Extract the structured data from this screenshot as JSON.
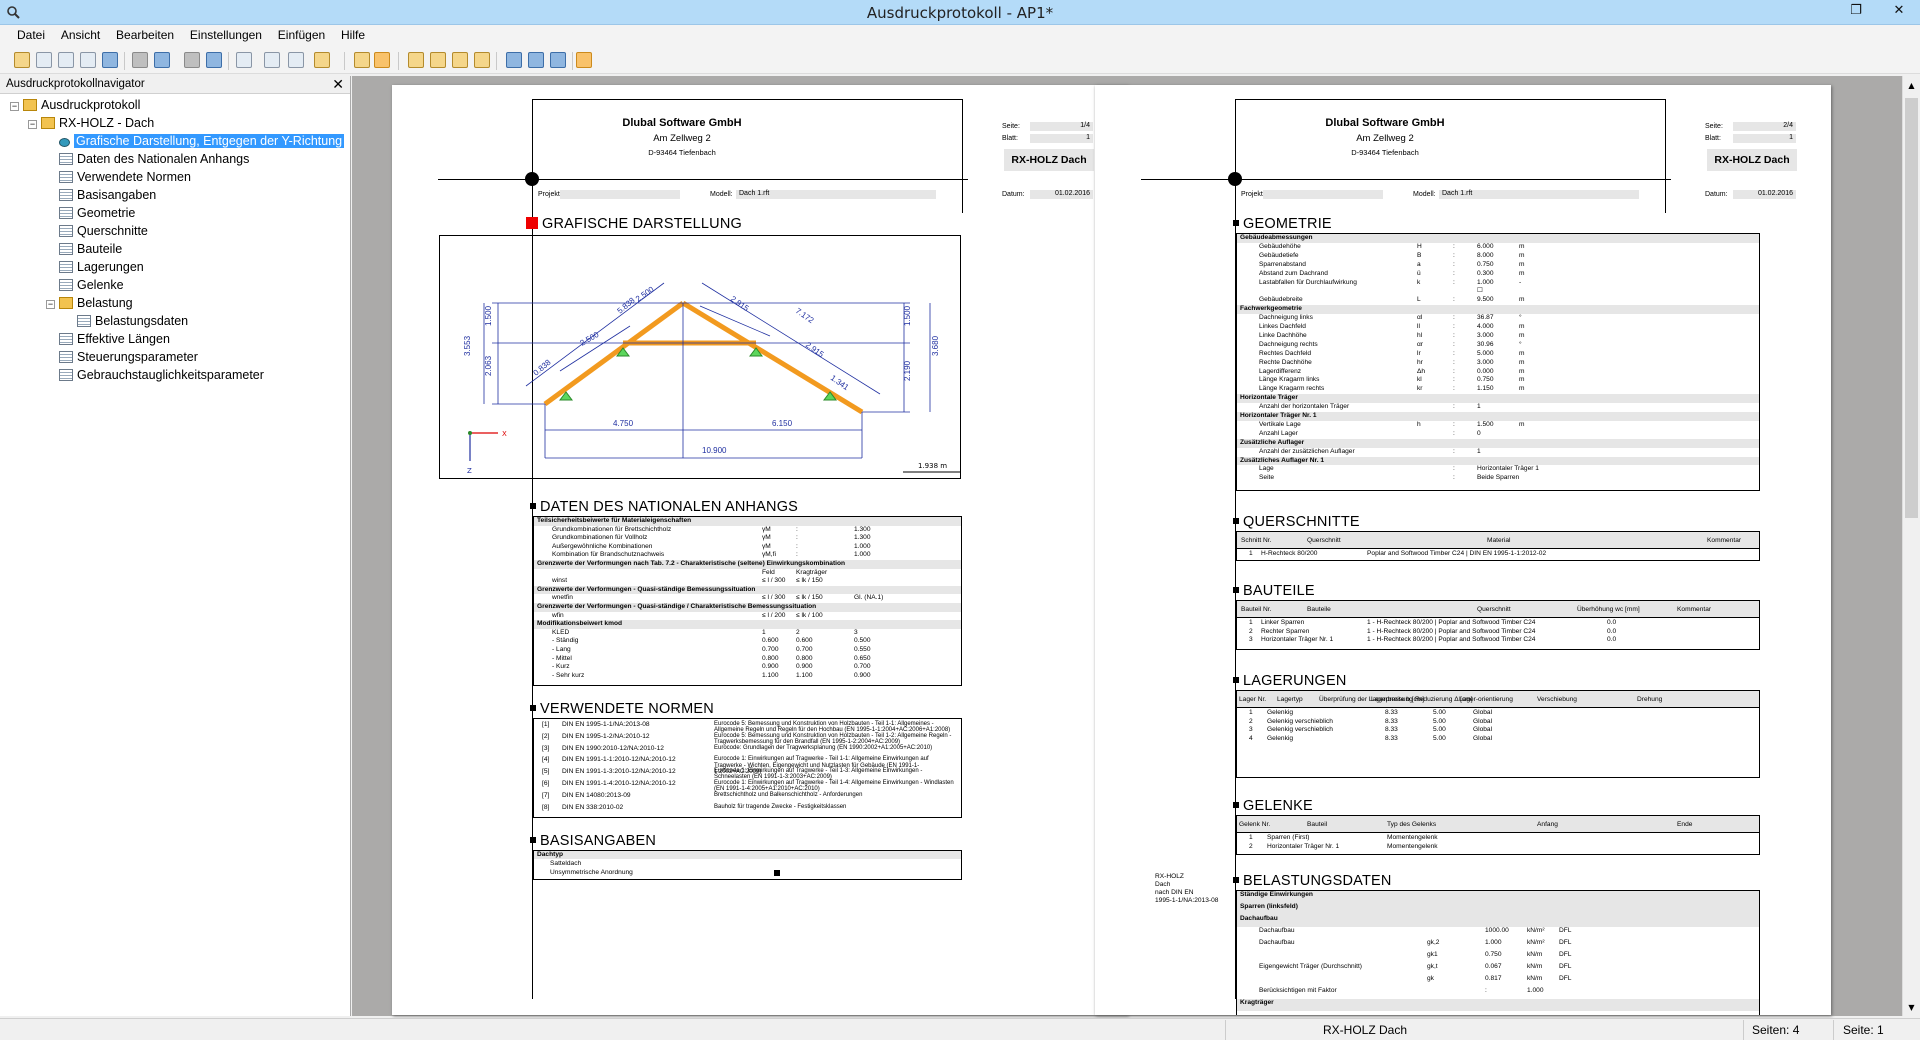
{
  "window": {
    "title": "Ausdruckprotokoll - AP1*",
    "restore_glyph": "❐",
    "close_glyph": "✕"
  },
  "menu": [
    "Datei",
    "Ansicht",
    "Bearbeiten",
    "Einstellungen",
    "Einfügen",
    "Hilfe"
  ],
  "navigator": {
    "title": "Ausdruckprotokollnavigator",
    "close": "✕",
    "items": [
      {
        "label": "Ausdruckprotokoll",
        "level": 0,
        "icon": "folder",
        "exp": "−"
      },
      {
        "label": "RX-HOLZ - Dach",
        "level": 1,
        "icon": "folder",
        "exp": "−"
      },
      {
        "label": "Grafische Darstellung, Entgegen der Y-Richtung",
        "level": 2,
        "icon": "eye",
        "selected": true
      },
      {
        "label": "Daten des Nationalen Anhangs",
        "level": 2,
        "icon": "table"
      },
      {
        "label": "Verwendete Normen",
        "level": 2,
        "icon": "table"
      },
      {
        "label": "Basisangaben",
        "level": 2,
        "icon": "table"
      },
      {
        "label": "Geometrie",
        "level": 2,
        "icon": "table"
      },
      {
        "label": "Querschnitte",
        "level": 2,
        "icon": "table"
      },
      {
        "label": "Bauteile",
        "level": 2,
        "icon": "table"
      },
      {
        "label": "Lagerungen",
        "level": 2,
        "icon": "table"
      },
      {
        "label": "Gelenke",
        "level": 2,
        "icon": "table"
      },
      {
        "label": "Belastung",
        "level": 2,
        "icon": "folder",
        "exp": "−"
      },
      {
        "label": "Belastungsdaten",
        "level": 3,
        "icon": "table"
      },
      {
        "label": "Effektive Längen",
        "level": 2,
        "icon": "table"
      },
      {
        "label": "Steuerungsparameter",
        "level": 2,
        "icon": "table"
      },
      {
        "label": "Gebrauchstauglichkeitsparameter",
        "level": 2,
        "icon": "table"
      }
    ]
  },
  "header": {
    "company": "Dlubal Software GmbH",
    "street": "Am Zellweg 2",
    "city": "D-93464 Tiefenbach",
    "seite_label": "Seite:",
    "blatt_label": "Blatt:",
    "projekt_label": "Projekt:",
    "modell_label": "Modell:",
    "modell_value": "Dach 1.rft",
    "datum_label": "Datum:",
    "datum_value": "01.02.2016",
    "module": "RX-HOLZ Dach"
  },
  "page1": {
    "seite": "1/4",
    "blatt": "1",
    "sec_grafik": "GRAFISCHE DARSTELLUNG",
    "drawing": {
      "dims": [
        "5.838",
        "2.500",
        "2.915",
        "7.172",
        "2.500",
        "2.915",
        "0.838",
        "1.341",
        "1.500",
        "3.553",
        "2.063",
        "1.500",
        "3.680",
        "2.190",
        "4.750",
        "6.150",
        "10.900"
      ],
      "scale": "1.938 m",
      "axis_x": "X",
      "axis_z": "Z"
    },
    "sec_nat": "DATEN DES NATIONALEN ANHANGS",
    "nat_rows": [
      [
        "Teilsicherheitsbeiwerte für Materialeigenschaften",
        "",
        "",
        "",
        ""
      ],
      [
        "Grundkombinationen für Brettschichtholz",
        "γM",
        ":",
        "1.300",
        ""
      ],
      [
        "Grundkombinationen für Vollholz",
        "γM",
        ":",
        "1.300",
        ""
      ],
      [
        "Außergewöhnliche Kombinationen",
        "γM",
        ":",
        "1.000",
        ""
      ],
      [
        "Kombination für Brandschutznachweis",
        "γM,fi",
        ":",
        "1.000",
        ""
      ],
      [
        "Grenzwerte der Verformungen nach Tab. 7.2 - Charakteristische (seltene) Einwirkungskombination",
        "",
        "",
        "",
        ""
      ],
      [
        "",
        "Feld",
        "Kragträger",
        "",
        ""
      ],
      [
        "winst",
        "≤ l / 300",
        "≤ lk / 150",
        "",
        ""
      ],
      [
        "Grenzwerte der Verformungen - Quasi-ständige Bemessungssituation",
        "",
        "",
        "",
        ""
      ],
      [
        "wnetfin",
        "≤ l / 300",
        "≤ lk / 150",
        "Gl. (NA.1)",
        ""
      ],
      [
        "Grenzwerte der Verformungen - Quasi-ständige / Charakteristische Bemessungssituation",
        "",
        "",
        "",
        ""
      ],
      [
        "wfin",
        "≤ l / 200",
        "≤ lk / 100",
        "",
        ""
      ],
      [
        "Modifikationsbeiwert kmod",
        "",
        "",
        "",
        ""
      ],
      [
        "KLED",
        "1",
        "2",
        "3",
        ""
      ],
      [
        "- Ständig",
        "0.600",
        "0.600",
        "0.500",
        ""
      ],
      [
        "- Lang",
        "0.700",
        "0.700",
        "0.550",
        ""
      ],
      [
        "- Mittel",
        "0.800",
        "0.800",
        "0.650",
        ""
      ],
      [
        "- Kurz",
        "0.900",
        "0.900",
        "0.700",
        ""
      ],
      [
        "- Sehr kurz",
        "1.100",
        "1.100",
        "0.900",
        ""
      ]
    ],
    "sec_normen": "VERWENDETE NORMEN",
    "normen": [
      [
        "[1]",
        "DIN EN 1995-1-1/NA:2013-08",
        "Eurocode 5: Bemessung und Konstruktion von Holzbauten - Teil 1-1: Allgemeines - Allgemeine Regeln und Regeln für den Hochbau (EN 1995-1-1:2004+AC:2006+A1:2008)"
      ],
      [
        "[2]",
        "DIN EN 1995-1-2/NA:2010-12",
        "Eurocode 5: Bemessung und Konstruktion von Holzbauten - Teil 1-2: Allgemeine Regeln - Tragwerksbemessung für den Brandfall (EN 1995-1-2:2004+AC:2009)"
      ],
      [
        "[3]",
        "DIN EN 1990:2010-12/NA:2010-12",
        "Eurocode: Grundlagen der Tragwerksplanung (EN 1990:2002+A1:2005+AC:2010)"
      ],
      [
        "[4]",
        "DIN EN 1991-1-1:2010-12/NA:2010-12",
        "Eurocode 1: Einwirkungen auf Tragwerke - Teil 1-1: Allgemeine Einwirkungen auf Tragwerke - Wichten, Eigengewicht und Nutzlasten für Gebäude (EN 1991-1-1:2002+AC:2009)"
      ],
      [
        "[5]",
        "DIN EN 1991-1-3:2010-12/NA:2010-12",
        "Eurocode 1: Einwirkungen auf Tragwerke - Teil 1-3: Allgemeine Einwirkungen - Schneelasten (EN 1991-1-3:2003+AC:2009)"
      ],
      [
        "[6]",
        "DIN EN 1991-1-4:2010-12/NA:2010-12",
        "Eurocode 1: Einwirkungen auf Tragwerke - Teil 1-4: Allgemeine Einwirkungen - Windlasten (EN 1991-1-4:2005+A1:2010+AC:2010)"
      ],
      [
        "[7]",
        "DIN EN 14080:2013-09",
        "Brettschichtholz und Balkenschichtholz - Anforderungen"
      ],
      [
        "[8]",
        "DIN EN 338:2010-02",
        "Bauholz für tragende Zwecke - Festigkeitsklassen"
      ]
    ],
    "sec_basis": "BASISANGABEN",
    "basis": [
      "Dachtyp",
      "Satteldach",
      "Unsymmetrische Anordnung"
    ]
  },
  "page2": {
    "seite": "2/4",
    "blatt": "1",
    "sec_geo": "GEOMETRIE",
    "geo_rows": [
      [
        "Gebäudeabmessungen",
        "",
        "",
        "",
        ""
      ],
      [
        "Gebäudehöhe",
        "H",
        ":",
        "6.000",
        "m"
      ],
      [
        "Gebäudetiefe",
        "B",
        ":",
        "8.000",
        "m"
      ],
      [
        "Sparrenabstand",
        "a",
        ":",
        "0.750",
        "m"
      ],
      [
        "Abstand zum Dachrand",
        "ü",
        ":",
        "0.300",
        "m"
      ],
      [
        "Lastabfallen für Durchlaufwirkung",
        "k",
        ":",
        "1.000",
        "-"
      ],
      [
        "",
        "",
        "",
        "☐",
        ""
      ],
      [
        "Gebäudebreite",
        "L",
        ":",
        "9.500",
        "m"
      ],
      [
        "Fachwerkgeometrie",
        "",
        "",
        "",
        ""
      ],
      [
        "Dachneigung links",
        "αl",
        ":",
        "36.87",
        "°"
      ],
      [
        "Linkes Dachfeld",
        "ll",
        ":",
        "4.000",
        "m"
      ],
      [
        "Linke Dachhöhe",
        "hl",
        ":",
        "3.000",
        "m"
      ],
      [
        "Dachneigung rechts",
        "αr",
        ":",
        "30.96",
        "°"
      ],
      [
        "Rechtes Dachfeld",
        "lr",
        ":",
        "5.000",
        "m"
      ],
      [
        "Rechte Dachhöhe",
        "hr",
        ":",
        "3.000",
        "m"
      ],
      [
        "Lagerdifferenz",
        "Δh",
        ":",
        "0.000",
        "m"
      ],
      [
        "Länge Kragarm links",
        "kl",
        ":",
        "0.750",
        "m"
      ],
      [
        "Länge Kragarm rechts",
        "kr",
        ":",
        "1.150",
        "m"
      ],
      [
        "Horizontale Träger",
        "",
        "",
        "",
        ""
      ],
      [
        "Anzahl der horizontalen Träger",
        "",
        ":",
        "1",
        ""
      ],
      [
        "Horizontaler Träger Nr. 1",
        "",
        "",
        "",
        ""
      ],
      [
        "Vertikale Lage",
        "h",
        ":",
        "1.500",
        "m"
      ],
      [
        "Anzahl Lager",
        "",
        ":",
        "0",
        ""
      ],
      [
        "Zusätzliche Auflager",
        "",
        "",
        "",
        ""
      ],
      [
        "Anzahl der zusätzlichen Auflager",
        "",
        ":",
        "1",
        ""
      ],
      [
        "Zusätzliches Auflager Nr. 1",
        "",
        "",
        "",
        ""
      ],
      [
        "Lage",
        "",
        ":",
        "Horizontaler Träger 1",
        ""
      ],
      [
        "Seite",
        "",
        ":",
        "Beide Sparren",
        ""
      ]
    ],
    "sec_qs": "QUERSCHNITTE",
    "qs_head": [
      "Schnitt Nr.",
      "Querschnitt",
      "Material",
      "Kommentar"
    ],
    "qs_rows": [
      [
        "1",
        "H-Rechteck 80/200",
        "Poplar and Softwood Timber C24 | DIN EN 1995-1-1:2012-02",
        ""
      ]
    ],
    "sec_bt": "BAUTEILE",
    "bt_head": [
      "Bauteil Nr.",
      "Bauteile",
      "Querschnitt",
      "Überhöhung wc [mm]",
      "Kommentar"
    ],
    "bt_rows": [
      [
        "1",
        "Linker Sparren",
        "1 - H-Rechteck 80/200 | Poplar and Softwood Timber C24",
        "0.0",
        ""
      ],
      [
        "2",
        "Rechter Sparren",
        "1 - H-Rechteck 80/200 | Poplar and Softwood Timber C24",
        "0.0",
        ""
      ],
      [
        "3",
        "Horizontaler Träger Nr. 1",
        "1 - H-Rechteck 80/200 | Poplar and Softwood Timber C24",
        "0.0",
        ""
      ]
    ],
    "sec_lag": "LAGERUNGEN",
    "lag_head": [
      "Lager Nr.",
      "Lagertyp",
      "Überprüfung der Lagerpressung",
      "Lagerbreite b [cm]",
      "Reduzierung Δ [cm]",
      "Lager-orientierung",
      "Verschiebung",
      "Drehung"
    ],
    "lag_rows": [
      [
        "1",
        "Gelenkig",
        "8.33",
        "5.00",
        "Global"
      ],
      [
        "2",
        "Gelenkig verschieblich",
        "8.33",
        "5.00",
        "Global"
      ],
      [
        "3",
        "Gelenkig verschieblich",
        "8.33",
        "5.00",
        "Global"
      ],
      [
        "4",
        "Gelenkig",
        "8.33",
        "5.00",
        "Global"
      ]
    ],
    "sec_gel": "GELENKE",
    "gel_head": [
      "Gelenk Nr.",
      "Bauteil",
      "Typ des Gelenks",
      "Anfang",
      "Ende"
    ],
    "gel_rows": [
      [
        "1",
        "Sparren (First)",
        "Momentengelenk"
      ],
      [
        "2",
        "Horizontaler Träger Nr. 1",
        "Momentengelenk"
      ]
    ],
    "sec_bel": "BELASTUNGSDATEN",
    "bel_rows": [
      [
        "Ständige Einwirkungen",
        "",
        "",
        "",
        ""
      ],
      [
        "Sparren (linksfeld)",
        "",
        "",
        "",
        ""
      ],
      [
        "Dachaufbau",
        "",
        "",
        "",
        ""
      ],
      [
        "Dachaufbau",
        "",
        "1000.00",
        "kN/m²",
        "DFL"
      ],
      [
        "Dachaufbau",
        "gk,2",
        "1.000",
        "kN/m²",
        "DFL"
      ],
      [
        "",
        "gk1",
        "0.750",
        "kN/m",
        "DFL"
      ],
      [
        "Eigengewicht Träger (Durchschnitt)",
        "gk,t",
        "0.067",
        "kN/m",
        "DFL"
      ],
      [
        "",
        "gk",
        "0.817",
        "kN/m",
        "DFL"
      ],
      [
        "Berücksichtigen mit Faktor",
        "",
        ":",
        "1.000",
        ""
      ],
      [
        "Kragträger",
        "",
        "",
        "",
        ""
      ]
    ],
    "side_note": [
      "RX-HOLZ",
      "Dach",
      "nach DIN EN",
      "1995-1-1/NA:2013-08"
    ]
  },
  "status": {
    "module": "RX-HOLZ Dach",
    "seiten": "Seiten: 4",
    "seite": "Seite: 1"
  }
}
